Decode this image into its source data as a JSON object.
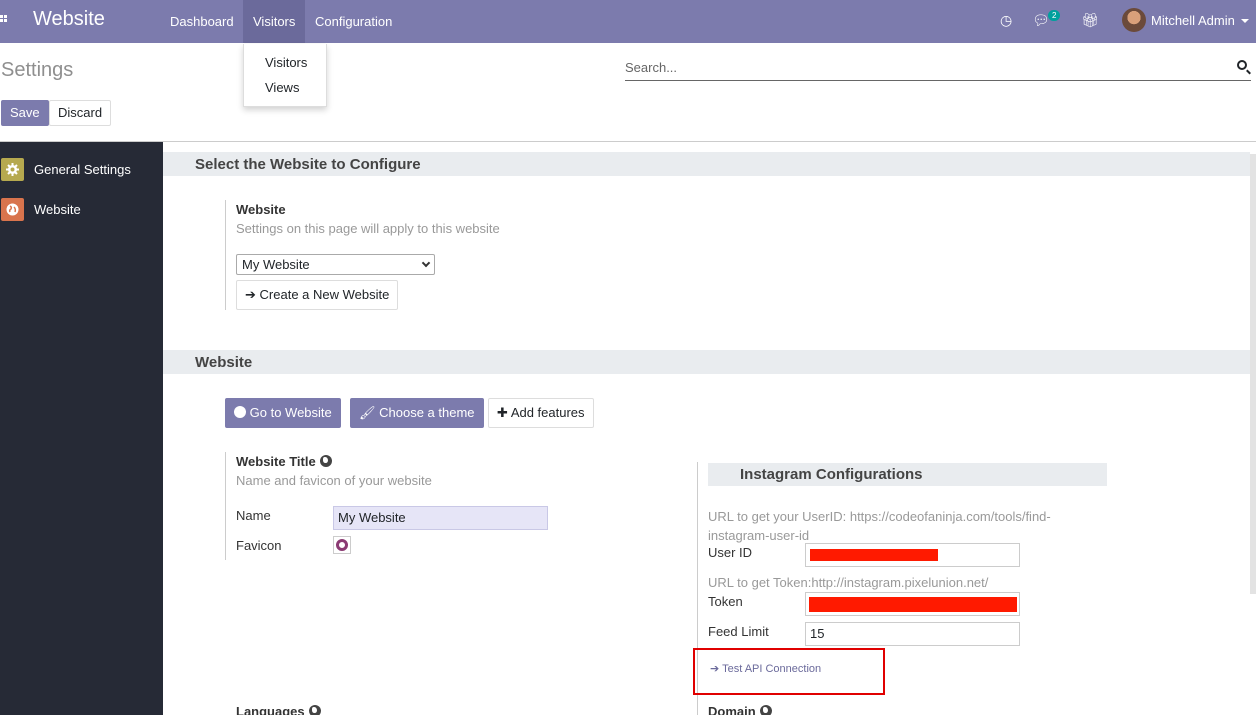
{
  "topbar": {
    "brand": "Website",
    "menu": [
      "Dashboard",
      "Visitors",
      "Configuration"
    ],
    "active_menu": "Visitors",
    "chat_badge": "2",
    "user_name": "Mitchell Admin"
  },
  "dropdown": {
    "items": [
      "Visitors",
      "Views"
    ]
  },
  "control_panel": {
    "title": "Settings",
    "search_placeholder": "Search...",
    "save_label": "Save",
    "discard_label": "Discard"
  },
  "sidebar": {
    "items": [
      {
        "label": "General Settings",
        "icon": "gear-icon",
        "color": "#b6a94f"
      },
      {
        "label": "Website",
        "icon": "globe-icon",
        "color": "#d9744d"
      }
    ]
  },
  "select_section": {
    "heading": "Select the Website to Configure",
    "label": "Website",
    "help": "Settings on this page will apply to this website",
    "selected_value": "My Website",
    "create_label": "Create a New Website"
  },
  "website_section": {
    "heading": "Website",
    "go_label": "Go to Website",
    "theme_label": "Choose a theme",
    "features_label": "Add features",
    "title_label": "Website Title",
    "title_help": "Name and favicon of your website",
    "name_label": "Name",
    "name_value": "My Website",
    "favicon_label": "Favicon",
    "languages_label": "Languages",
    "domain_label": "Domain"
  },
  "instagram": {
    "heading": "Instagram Configurations",
    "userid_help": "URL to get your UserID: https://codeofaninja.com/tools/find-instagram-user-id",
    "userid_label": "User ID",
    "token_help": "URL to get Token:http://instagram.pixelunion.net/",
    "token_label": "Token",
    "feed_label": "Feed Limit",
    "feed_value": "15",
    "test_label": "Test API Connection"
  },
  "colors": {
    "primary": "#7c7bad",
    "highlight": "#e00000",
    "sidebar_bg": "#262a36"
  }
}
